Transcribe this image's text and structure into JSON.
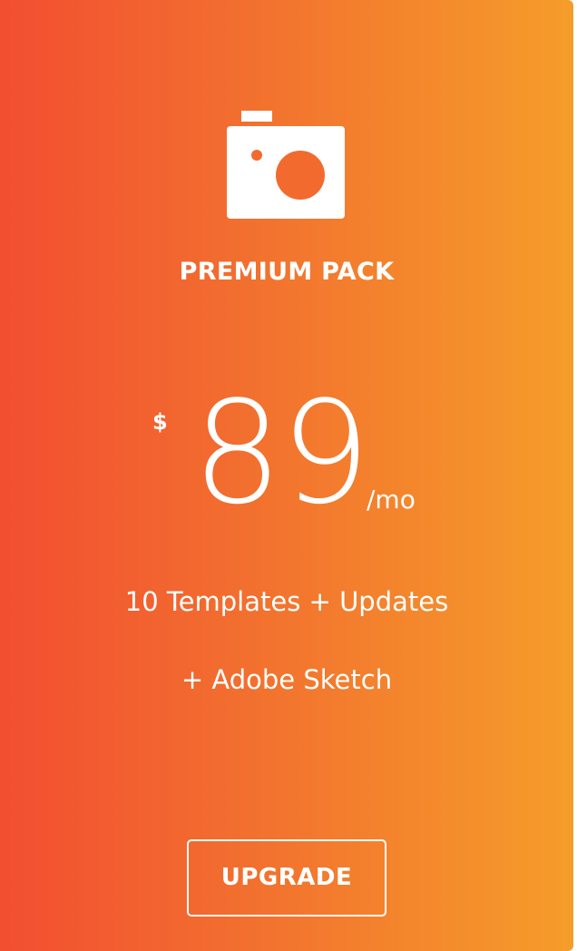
{
  "plan": {
    "icon": "camera-icon",
    "name": "PREMIUM PACK",
    "currency": "$",
    "price": "89",
    "period": "/mo",
    "features": [
      "10 Templates + Updates",
      "+ Adobe Sketch"
    ],
    "cta_label": "UPGRADE"
  },
  "colors": {
    "gradient_start": "#f24e30",
    "gradient_end": "#f59d2a",
    "text": "#ffffff"
  }
}
